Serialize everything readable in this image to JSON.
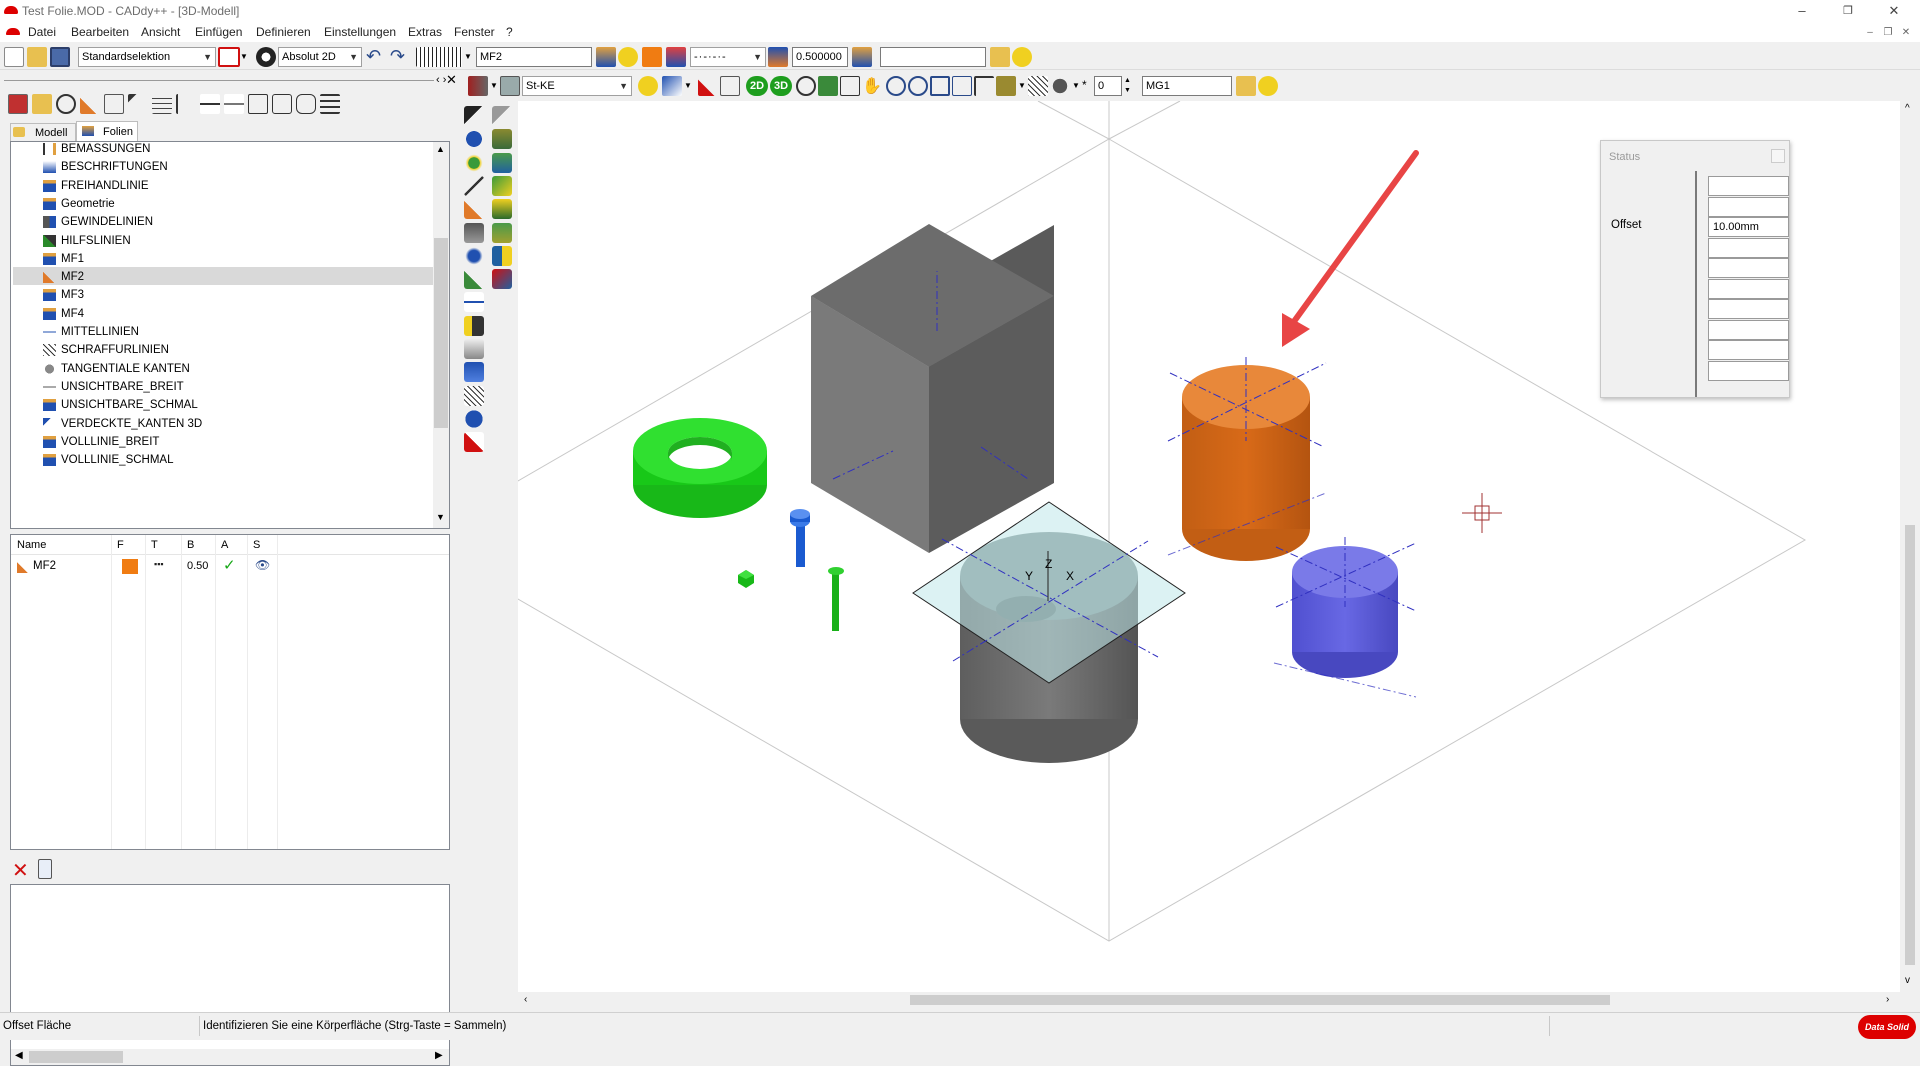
{
  "window": {
    "title": "Test Folie.MOD  -  CADdy++ - [3D-Modell]",
    "minimize": "–",
    "restore": "❐",
    "close": "✕"
  },
  "menu": [
    "Datei",
    "Bearbeiten",
    "Ansicht",
    "Einfügen",
    "Definieren",
    "Einstellungen",
    "Extras",
    "Fenster",
    "?"
  ],
  "toolbar1": {
    "selection_mode": "Standardselektion",
    "coord_mode": "Absolut 2D",
    "layer_name": "MF2",
    "line_width": "0.500000",
    "empty_field": ""
  },
  "toolbar2": {
    "material": "St-KE",
    "btn_2d": "2D",
    "btn_3d": "3D",
    "number_field": "0",
    "group_field": "MG1"
  },
  "left_panel": {
    "tabs": [
      "Modell",
      "Folien"
    ],
    "layers": [
      {
        "name": "BEMASSUNGEN",
        "icon": "dimension-icon",
        "selected": false
      },
      {
        "name": "BESCHRIFTUNGEN",
        "icon": "text-icon",
        "selected": false
      },
      {
        "name": "FREIHANDLINIE",
        "icon": "layer-icon",
        "selected": false
      },
      {
        "name": "Geometrie",
        "icon": "layer-icon",
        "selected": false
      },
      {
        "name": "GEWINDELINIEN",
        "icon": "thread-icon",
        "selected": false
      },
      {
        "name": "HILFSLINIEN",
        "icon": "helpline-icon",
        "selected": false
      },
      {
        "name": "MF1",
        "icon": "layer-icon",
        "selected": false
      },
      {
        "name": "MF2",
        "icon": "pencil-icon",
        "selected": true
      },
      {
        "name": "MF3",
        "icon": "layer-icon",
        "selected": false
      },
      {
        "name": "MF4",
        "icon": "layer-icon",
        "selected": false
      },
      {
        "name": "MITTELLINIEN",
        "icon": "centerline-icon",
        "selected": false
      },
      {
        "name": "SCHRAFFURLINIEN",
        "icon": "hatch-icon",
        "selected": false
      },
      {
        "name": "TANGENTIALE KANTEN",
        "icon": "tangent-icon",
        "selected": false
      },
      {
        "name": "UNSICHTBARE_BREIT",
        "icon": "dashed-icon",
        "selected": false
      },
      {
        "name": "UNSICHTBARE_SCHMAL",
        "icon": "layer-icon",
        "selected": false
      },
      {
        "name": "VERDECKTE_KANTEN 3D",
        "icon": "hidden-edge-icon",
        "selected": false
      },
      {
        "name": "VOLLLINIE_BREIT",
        "icon": "layer-icon",
        "selected": false
      },
      {
        "name": "VOLLLINIE_SCHMAL",
        "icon": "layer-icon",
        "selected": false
      }
    ],
    "props_headers": [
      "Name",
      "F",
      "T",
      "B",
      "A",
      "S"
    ],
    "props_row": {
      "name": "MF2",
      "color": "#f07c12",
      "type": "▪▪▪",
      "width": "0.50",
      "active": "✓",
      "visible": "👁"
    }
  },
  "status_panel": {
    "title": "Status",
    "offset_label": "Offset",
    "offset_value": "10.00mm"
  },
  "statusbar": {
    "mode": "Offset Fläche",
    "prompt": "Identifizieren Sie eine Körperfläche (Strg-Taste = Sammeln)",
    "brand": "Data Solid"
  },
  "colors": {
    "orange": "#e07a2a",
    "green": "#22e022",
    "blue": "#6a6ae0",
    "gray": "#6e6e6e",
    "arrow": "#e84545"
  }
}
